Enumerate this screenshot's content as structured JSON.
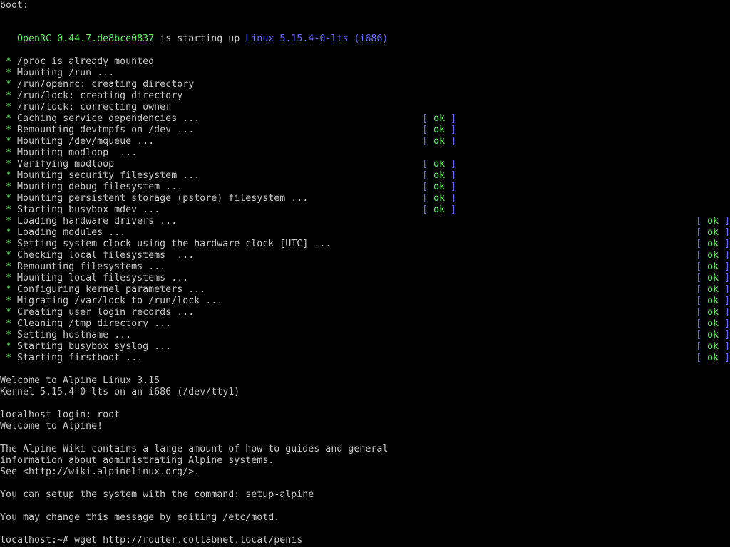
{
  "header": {
    "boot_label": "boot:",
    "openrc_name": "OpenRC",
    "openrc_version": "0.44.7.de8bce0837",
    "starting_text": "is starting up",
    "kernel_text": "Linux 5.15.4-0-lts (i686)"
  },
  "boot_lines": [
    {
      "text": "/proc is already mounted",
      "status": ""
    },
    {
      "text": "Mounting /run ...",
      "status": ""
    },
    {
      "text": "/run/openrc: creating directory",
      "status": ""
    },
    {
      "text": "/run/lock: creating directory",
      "status": ""
    },
    {
      "text": "/run/lock: correcting owner",
      "status": ""
    },
    {
      "text": "Caching service dependencies ...",
      "status": "ok",
      "col": "mid"
    },
    {
      "text": "Remounting devtmpfs on /dev ...",
      "status": "ok",
      "col": "mid"
    },
    {
      "text": "Mounting /dev/mqueue ...",
      "status": "ok",
      "col": "mid"
    },
    {
      "text": "Mounting modloop  ...",
      "status": ""
    },
    {
      "text": "Verifying modloop",
      "status": "ok",
      "col": "mid"
    },
    {
      "text": "Mounting security filesystem ...",
      "status": "ok",
      "col": "mid"
    },
    {
      "text": "Mounting debug filesystem ...",
      "status": "ok",
      "col": "mid"
    },
    {
      "text": "Mounting persistent storage (pstore) filesystem ...",
      "status": "ok",
      "col": "mid"
    },
    {
      "text": "Starting busybox mdev ...",
      "status": "ok",
      "col": "mid"
    },
    {
      "text": "Loading hardware drivers ...",
      "status": "ok",
      "col": "right"
    },
    {
      "text": "Loading modules ...",
      "status": "ok",
      "col": "right"
    },
    {
      "text": "Setting system clock using the hardware clock [UTC] ...",
      "status": "ok",
      "col": "right"
    },
    {
      "text": "Checking local filesystems  ...",
      "status": "ok",
      "col": "right"
    },
    {
      "text": "Remounting filesystems ...",
      "status": "ok",
      "col": "right"
    },
    {
      "text": "Mounting local filesystems ...",
      "status": "ok",
      "col": "right"
    },
    {
      "text": "Configuring kernel parameters ...",
      "status": "ok",
      "col": "right"
    },
    {
      "text": "Migrating /var/lock to /run/lock ...",
      "status": "ok",
      "col": "right"
    },
    {
      "text": "Creating user login records ...",
      "status": "ok",
      "col": "right"
    },
    {
      "text": "Cleaning /tmp directory ...",
      "status": "ok",
      "col": "right"
    },
    {
      "text": "Setting hostname ...",
      "status": "ok",
      "col": "right"
    },
    {
      "text": "Starting busybox syslog ...",
      "status": "ok",
      "col": "right"
    },
    {
      "text": "Starting firstboot ...",
      "status": "ok",
      "col": "right"
    }
  ],
  "star_glyph": "*",
  "ok_open": "[ ",
  "ok_label": "ok",
  "ok_close": " ]",
  "welcome": {
    "line1": "Welcome to Alpine Linux 3.15",
    "line2": "Kernel 5.15.4-0-lts on an i686 (/dev/tty1)"
  },
  "login": {
    "prompt_line": "localhost login: root",
    "welcome": "Welcome to Alpine!"
  },
  "motd": {
    "line1": "The Alpine Wiki contains a large amount of how-to guides and general",
    "line2": "information about administrating Alpine systems.",
    "line3": "See <http://wiki.alpinelinux.org/>.",
    "line4": "You can setup the system with the command: setup-alpine",
    "line5": "You may change this message by editing /etc/motd."
  },
  "shell": {
    "prompt": "localhost:~# ",
    "command": "wget http://router.collabnet.local/penis"
  },
  "colors": {
    "background": "#000000",
    "text": "#c8c8c8",
    "green": "#5ef05e",
    "blue": "#6b6bff"
  }
}
